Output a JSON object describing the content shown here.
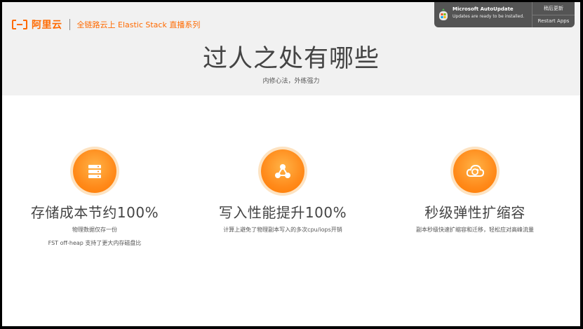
{
  "brand": {
    "name": "阿里云",
    "series": "全链路云上 Elastic Stack 直播系列"
  },
  "header": {
    "title": "过人之处有哪些",
    "subtitle": "内修心法，外练强力"
  },
  "notification": {
    "app": "Microsoft AutoUpdate",
    "message": "Updates are ready to be installed.",
    "actions": [
      "稍后更新",
      "Restart Apps"
    ]
  },
  "features": [
    {
      "icon": "server-stack-icon",
      "title": "存储成本节约100%",
      "desc": "物理数据仅存一份",
      "desc2": "FST off-heap 支持了更大内存磁盘比"
    },
    {
      "icon": "share-nodes-icon",
      "title": "写入性能提升100%",
      "desc": "计算上避免了物理副本写入的多次cpu/iops开销"
    },
    {
      "icon": "cloud-sync-icon",
      "title": "秒级弹性扩缩容",
      "desc": "副本秒级快速扩缩容和迁移，轻松应对高峰流量"
    }
  ]
}
